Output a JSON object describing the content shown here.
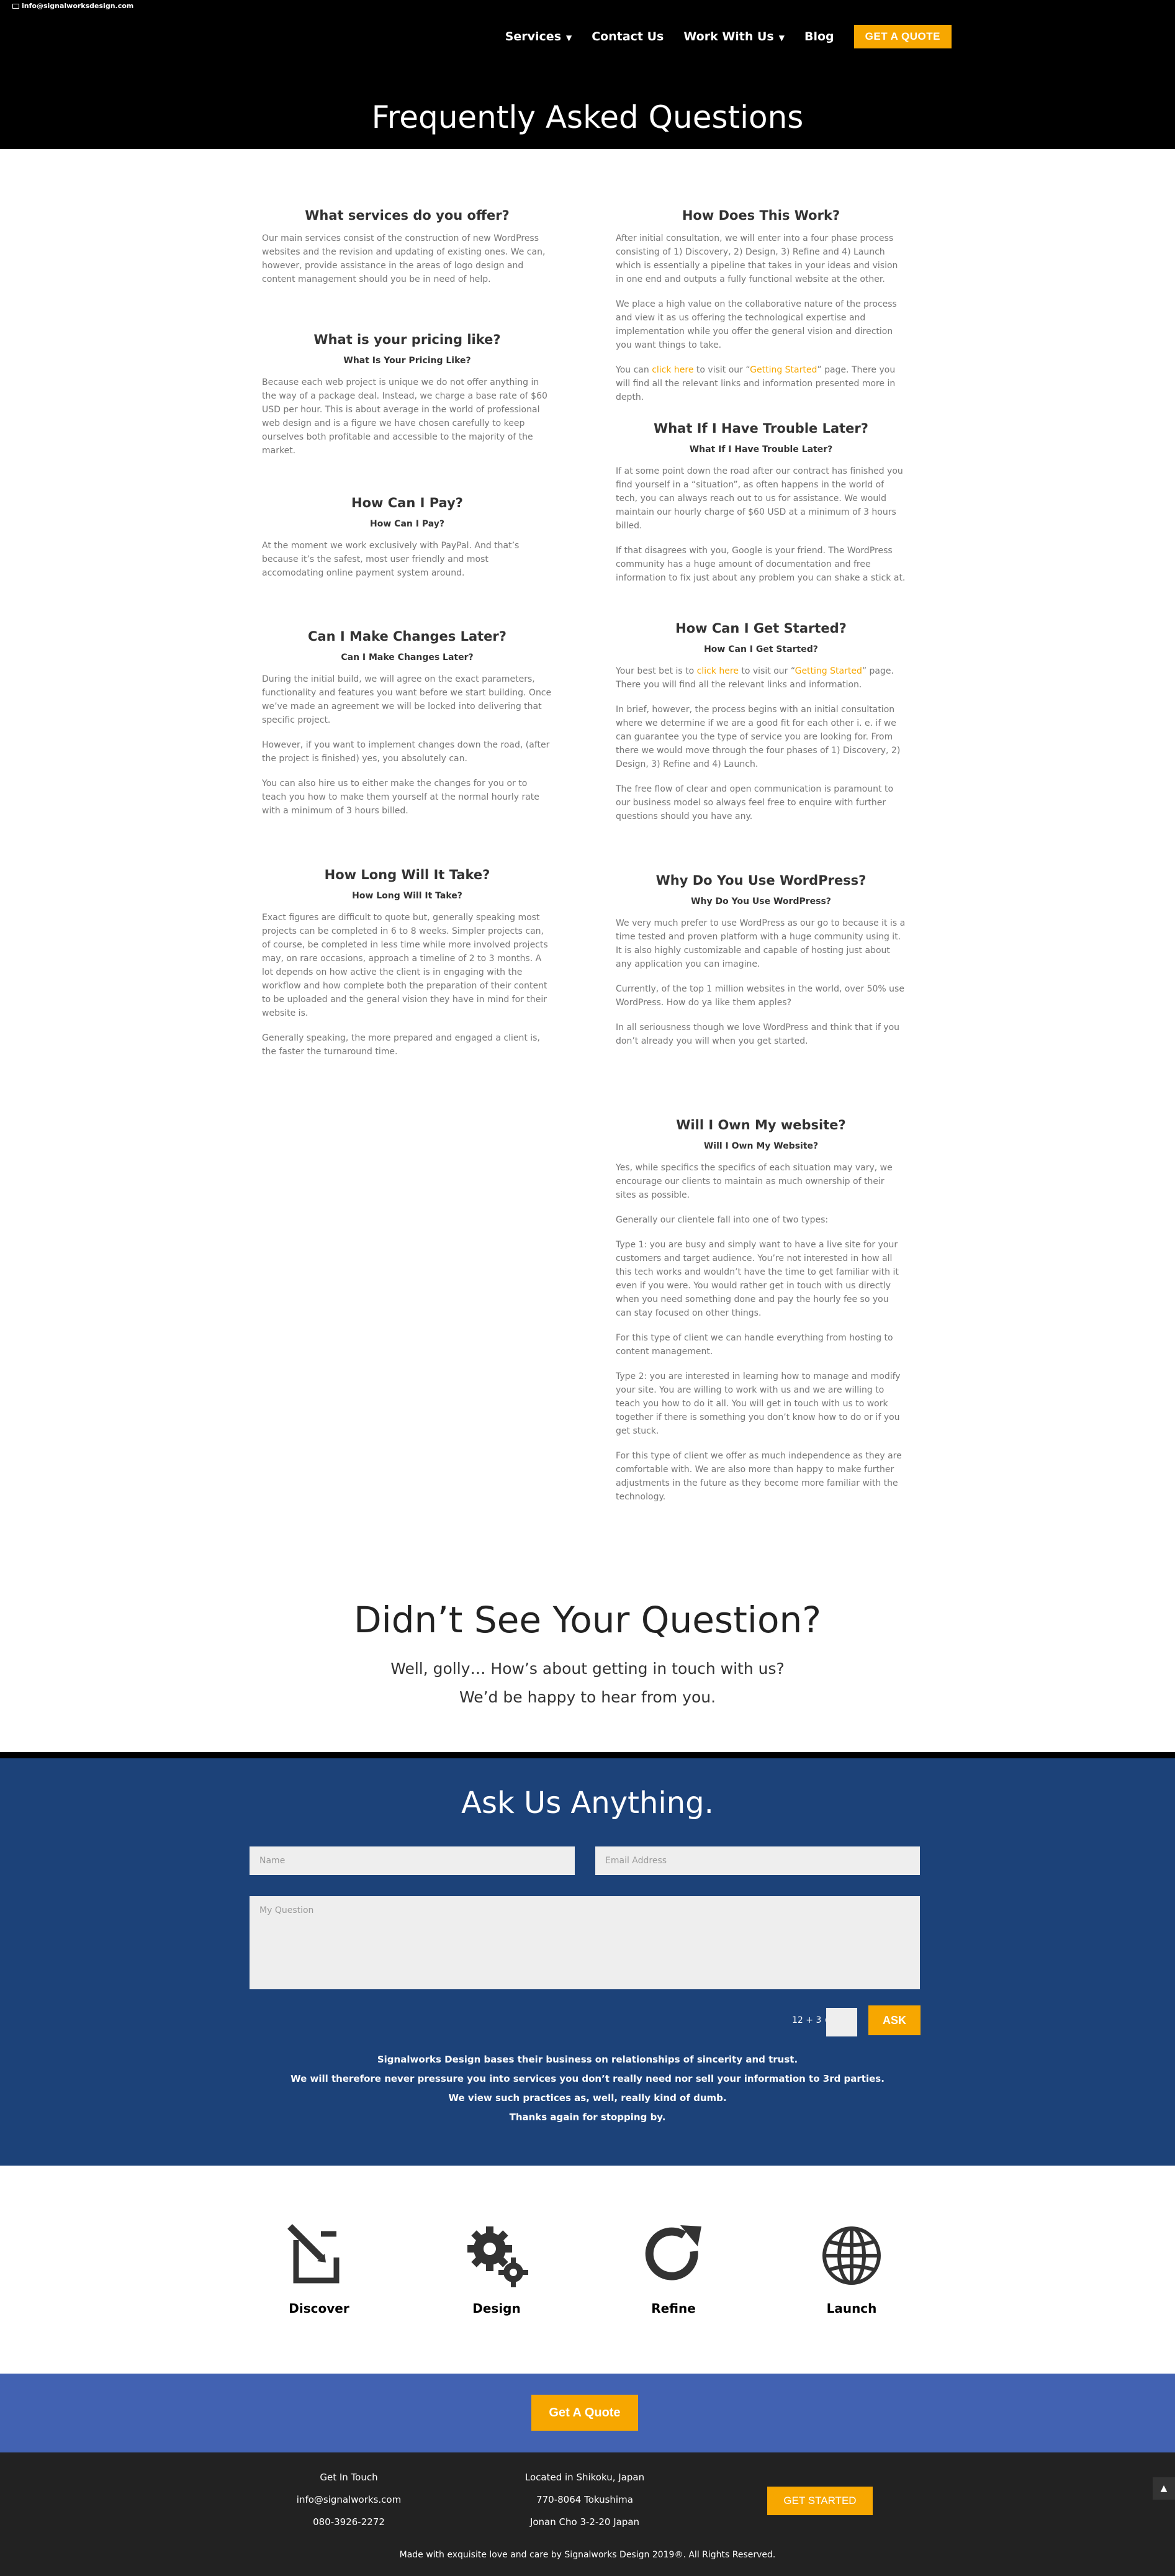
{
  "topbar": {
    "email": "info@signalworksdesign.com"
  },
  "nav": {
    "services": "Services",
    "contact": "Contact Us",
    "work": "Work With Us",
    "blog": "Blog",
    "quote": "GET A QUOTE"
  },
  "hero": {
    "title": "Frequently Asked Questions"
  },
  "faq_left": [
    {
      "title": "What services do you offer?",
      "paras": [
        "Our main services consist of the construction of new WordPress websites and the revision and updating of existing ones. We can, however, provide assistance in the areas of logo design and content management should you be in need of help."
      ]
    },
    {
      "title": "What is your pricing like?",
      "sub": "What Is Your Pricing Like?",
      "paras": [
        "Because each web project is unique we do not offer anything in the way of a package deal. Instead, we charge a base rate of $60 USD per hour. This is about average in the world of professional web design and is a figure we have chosen carefully to keep ourselves both profitable and accessible to the majority of the market."
      ]
    },
    {
      "title": "How Can I Pay?",
      "sub": "How Can I Pay?",
      "paras": [
        "At the moment we work exclusively with PayPal. And that’s because it’s the safest, most user friendly and most accomodating online payment system around."
      ]
    },
    {
      "title": "Can I Make Changes Later?",
      "sub": "Can I Make Changes Later?",
      "paras": [
        "During the initial build, we will agree on the exact parameters, functionality and features you want before we start building. Once we’ve made an agreement we will be locked into delivering that specific project.",
        "However, if you want to implement changes down the road, (after the project is finished) yes, you absolutely can.",
        "You can also hire us to either make the changes for you or to teach you how to make them yourself at the normal hourly rate with a minimum of 3 hours billed."
      ]
    },
    {
      "title": "How Long Will It Take?",
      "sub": "How Long Will It Take?",
      "paras": [
        "Exact figures are difficult to quote but, generally speaking most projects can be completed in 6 to 8 weeks. Simpler projects can, of course, be completed in less time while more involved projects may, on rare occasions,  approach a timeline of 2 to 3 months. A lot depends on how active the client is in engaging with the workflow and how complete both the preparation of their content to be uploaded and the general vision they have in mind for their website is.",
        "Generally speaking, the more prepared and engaged a client is, the faster the turnaround time."
      ]
    }
  ],
  "faq_right": [
    {
      "title": "How Does This Work?",
      "paras": [
        "After initial consultation, we will enter into a four phase process consisting of 1) Discovery, 2) Design, 3) Refine and 4) Launch which is essentially a pipeline that takes in your ideas and vision in one end and outputs a fully functional website at the other.",
        "We place a high value on the collaborative nature of the process and view it as us offering the technological expertise and implementation while you offer the general vision and direction you want things to take."
      ],
      "link_para": {
        "before": "You can ",
        "link1": "click here",
        "mid": " to visit our “",
        "link2": "Getting Started",
        "after": "” page. There you will find all the relevant links and information presented more in depth."
      }
    },
    {
      "title": "What If I Have Trouble Later?",
      "sub": "What If I Have Trouble Later?",
      "paras": [
        "If at some point down the road after our contract has finished you find yourself in a “situation”, as often happens in the world of tech, you can always reach out to us for assistance. We would maintain our hourly charge of $60 USD at a minimum of 3 hours billed.",
        "If that disagrees with you, Google is your friend. The WordPress community has a huge amount of documentation and free information to fix just about any problem you can shake a stick at."
      ]
    },
    {
      "title": "How Can I Get Started?",
      "sub": "How Can I Get Started?",
      "link_para": {
        "before": "Your best bet is to ",
        "link1": "click here",
        "mid": " to visit our “",
        "link2": "Getting Started",
        "after": "” page. There you will find all the relevant links and information."
      },
      "paras": [
        "In brief, however, the process begins with an initial consultation where we determine if we are a good fit for each other i. e. if we can guarantee you the type of service you are looking for. From there we would move through the four phases of 1) Discovery, 2) Design, 3) Refine and 4) Launch.",
        "The free flow of clear and open communication is paramount to our business model so always feel free to enquire with further questions should you have any."
      ]
    },
    {
      "title": "Why Do You Use WordPress?",
      "sub": "Why Do You Use WordPress?",
      "paras": [
        "We very much prefer to use WordPress as our go to because it is a time tested and proven platform with a huge community using it. It is also highly customizable and capable of hosting just about any application you can imagine.",
        "Currently, of the top 1 million websites in the world, over 50% use WordPress. How do ya like them apples?",
        "In all seriousness though we love WordPress and think that if you don’t already you will when you get started."
      ]
    },
    {
      "title": "Will I Own My website?",
      "sub": "Will I Own My Website?",
      "paras": [
        "Yes, while specifics the specifics of each situation may vary, we encourage our clients to maintain as much ownership of their sites as possible.",
        "Generally our clientele fall into one of two types:",
        "Type 1: you are busy and simply want to have a live site for your customers and target audience. You’re not interested in how all this tech works and wouldn’t have the time to get familiar with it even if you were. You would rather get in touch with us directly when you need something done and pay the hourly fee so you can stay focused on other things.",
        "For this type of client we can handle everything from hosting to content management.",
        "Type 2: you are interested in learning how to manage and modify your site. You are willing to work with us and we are willing to teach you how to do it all. You will get in touch with us to work together if there is something you don’t know how to do or if you get stuck.",
        "For this type of client we offer as much independence as they are comfortable with. We are also more than happy to make further adjustments in the future as they become more familiar with the technology."
      ]
    }
  ],
  "didnt": {
    "title": "Didn’t See Your Question?",
    "line1": "Well, golly… How’s about getting in touch with us?",
    "line2": "We’d be happy to hear from you."
  },
  "ask": {
    "title": "Ask Us Anything.",
    "name_placeholder": "Name",
    "email_placeholder": "Email Address",
    "question_placeholder": "My Question",
    "captcha": "12 + 3 =",
    "button": "ASK",
    "note": [
      "Signalworks Design bases their business on relationships of sincerity and trust.",
      "We will therefore never pressure you into services you don’t really need nor sell your information to 3rd parties.",
      "We view such practices as, well, really kind of dumb.",
      "Thanks again for stopping by."
    ]
  },
  "process": [
    {
      "label": "Discover",
      "icon": "edit-icon"
    },
    {
      "label": "Design",
      "icon": "gears-icon"
    },
    {
      "label": "Refine",
      "icon": "refresh-icon"
    },
    {
      "label": "Launch",
      "icon": "globe-icon"
    }
  ],
  "cta": {
    "button": "Get A Quote"
  },
  "footer": {
    "get_in_touch": "Get In Touch",
    "email": "info@signalworks.com",
    "phone": "080-3926-2272",
    "location": "Located in Shikoku, Japan",
    "address1": "770-8064 Tokushima",
    "address2": "Jonan Cho 3-2-20 Japan",
    "started": "GET STARTED",
    "copyright": "Made with exquisite love and care by Signalworks Design 2019®. All Rights Reserved."
  },
  "colors": {
    "accent": "#f7a700",
    "navy": "#1c4279",
    "cta_blue": "#4262b2",
    "footer": "#222222"
  }
}
